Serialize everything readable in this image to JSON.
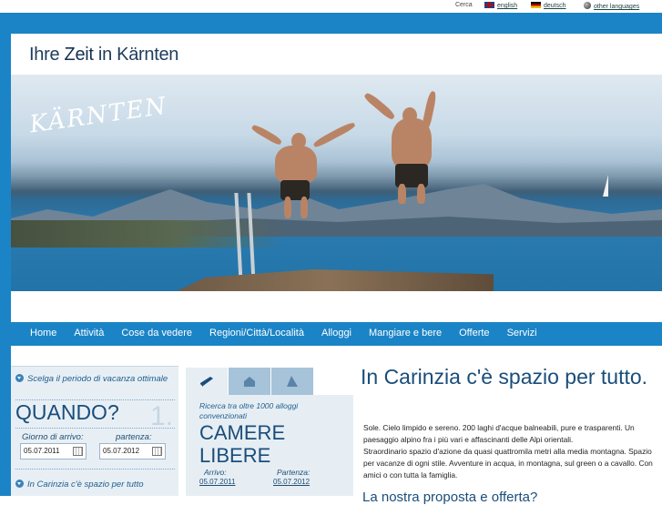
{
  "topbar": {
    "search_label": "Cerca",
    "languages": [
      {
        "label": "english",
        "flag": "uk-flag-icon"
      },
      {
        "label": "deutsch",
        "flag": "austria-flag-icon"
      },
      {
        "label": "other languages",
        "flag": "globe-icon"
      }
    ]
  },
  "header": {
    "title_part1": "Ihre ",
    "title_bold": "Zeit",
    "title_part2": " in Kärnten"
  },
  "hero": {
    "logo_text": "KÄRNTEN"
  },
  "nav": {
    "items": [
      "Home",
      "Attività",
      "Cose da vedere",
      "Regioni/Città/Località",
      "Alloggi",
      "Mangiare e bere",
      "Offerte",
      "Servizi"
    ]
  },
  "period_box": {
    "heading": "Scelga il periodo di vacanza ottimale",
    "big_label": "QUANDO?",
    "step": "1.",
    "arrival_label": "Giorno di arrivo:",
    "departure_label": "partenza:",
    "arrival_value": "05.07.2011",
    "departure_value": "05.07.2012",
    "footer": "In Carinzia c'è spazio per tutto"
  },
  "rooms_box": {
    "tabs": [
      "bed-icon",
      "house-icon",
      "tent-icon"
    ],
    "subheading": "Ricerca tra oltre 1000 alloggi convenzionati",
    "big_line1": "CAMERE",
    "big_line2": "LIBERE",
    "arrival_label": "Arrivo:",
    "departure_label": "Partenza:",
    "arrival_value": "05.07.2011",
    "departure_value": "05.07.2012"
  },
  "main": {
    "heading": "In Carinzia c'è spazio per tutto.",
    "paragraph1": "Sole. Cielo limpido e sereno. 200 laghi d'acque balneabili, pure e trasparenti. Un paesaggio alpino fra i più vari e affascinanti delle Alpi orientali.",
    "paragraph2": "Straordinario spazio d'azione da quasi quattromila metri alla media montagna. Spazio per vacanze di ogni stile. Avventure in acqua, in montagna, sul green o a cavallo. Con amici o con tutta la famiglia.",
    "subheading_partial": "La nostra proposta e offerta?"
  },
  "colors": {
    "brand_blue": "#1b84c6",
    "heading_blue": "#1a4d7a",
    "panel_bg": "#e7eff5"
  }
}
